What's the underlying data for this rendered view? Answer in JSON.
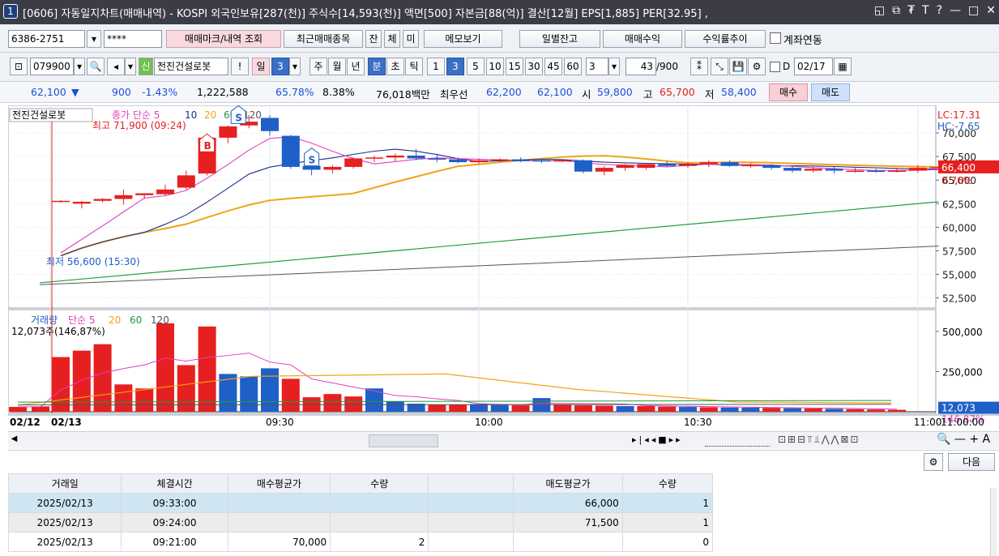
{
  "title": {
    "badge": "1",
    "text": "[0606] 자동일지차트(매매내역) - KOSPI 외국인보유[287(천)] 주식수[14,593(천)] 액면[500] 자본금[88(억)] 결산[12월] EPS[1,885] PER[32.95] ,"
  },
  "toolbar1": {
    "account": "6386-2751",
    "password": "****",
    "btn_trade_mark": "매매마크/내역 조회",
    "btn_recent": "최근매매종목",
    "btn_jan": "잔",
    "btn_che": "체",
    "btn_mi": "미",
    "btn_memo": "메모보기",
    "btn_daily_balance": "일별잔고",
    "btn_trade_profit": "매매수익",
    "btn_return_trend": "수익률추이",
    "chk_account_link": "계좌연동"
  },
  "toolbar2": {
    "code": "079900",
    "new_badge": "신",
    "stock_name": "전진건설로봇",
    "excl": "!",
    "period_il": "일",
    "period_num": "3",
    "ju": "주",
    "wol": "월",
    "nyeon": "년",
    "bun": "분",
    "cho": "초",
    "tik": "틱",
    "intervals": [
      "1",
      "3",
      "5",
      "10",
      "15",
      "30",
      "45",
      "60"
    ],
    "interval_sel": "3",
    "count": "43",
    "total": "/900",
    "chk_d": "D",
    "date": "02/17"
  },
  "quote": {
    "price": "62,100",
    "arrow": "▼",
    "change": "900",
    "rate": "-1.43%",
    "volume": "1,222,588",
    "v_ratio": "65.78%",
    "turnover": "8.38%",
    "amount": "76,018백만",
    "best_label": "최우선",
    "best_ask": "62,200",
    "best_bid": "62,100",
    "open_label": "시",
    "open": "59,800",
    "high_label": "고",
    "high": "65,700",
    "low_label": "저",
    "low": "58,400",
    "buy": "매수",
    "sell": "매도"
  },
  "chart": {
    "legend_name": "전진건설로봇",
    "legend_price": "종가 단순 5",
    "ma10": "10",
    "ma20": "20",
    "ma60": "60",
    "ma120": "120",
    "high_note": "최고 71,900 (09:24)",
    "low_note": "최저 56,600 (15:30)",
    "lc": "LC:17.31",
    "hc": "HC:-7.65",
    "price_axis": [
      "70,000",
      "67,500",
      "65,000",
      "62,500",
      "60,000",
      "57,500",
      "55,000",
      "52,500"
    ],
    "cur_price": "66,400",
    "cur_rate": "0.76%",
    "vol_legend": "거래량",
    "vol_ma": "단순 5",
    "vol_ma20": "20",
    "vol_ma60": "60",
    "vol_ma120": "120",
    "vol_info": "12,073주(146,87%)",
    "vol_axis": [
      "500,000",
      "250,000"
    ],
    "vol_cur": "12,073",
    "vol_rate": "146.87%",
    "time_axis": [
      "02/12",
      "02/13",
      "09:30",
      "10:00",
      "10:30",
      "11:00"
    ],
    "time_end": "11:00:00",
    "candles": [
      [
        62800,
        62900,
        62600,
        62800
      ],
      [
        62500,
        62800,
        62000,
        62700
      ],
      [
        62800,
        63100,
        62600,
        63000
      ],
      [
        63000,
        64000,
        62400,
        63400
      ],
      [
        63400,
        63600,
        63000,
        63600
      ],
      [
        63500,
        64500,
        63300,
        64000
      ],
      [
        64200,
        66000,
        64000,
        65500
      ],
      [
        65700,
        69700,
        65500,
        69500
      ],
      [
        69500,
        70800,
        68900,
        70700
      ],
      [
        70800,
        71900,
        70500,
        71200
      ],
      [
        71600,
        71900,
        69700,
        70200
      ],
      [
        69700,
        69800,
        66200,
        66400
      ],
      [
        66500,
        67200,
        65500,
        66100
      ],
      [
        66100,
        66600,
        65700,
        66400
      ],
      [
        66400,
        67400,
        66200,
        67300
      ],
      [
        67300,
        67600,
        66900,
        67400
      ],
      [
        67400,
        67800,
        67000,
        67600
      ],
      [
        67600,
        68300,
        67100,
        67300
      ],
      [
        67300,
        67800,
        66900,
        67200
      ],
      [
        67200,
        67400,
        66800,
        66900
      ],
      [
        66900,
        67300,
        66700,
        67100
      ],
      [
        67100,
        67300,
        66900,
        67200
      ],
      [
        67200,
        67400,
        66900,
        67000
      ],
      [
        67100,
        67300,
        66800,
        67000
      ],
      [
        67000,
        67200,
        66900,
        67100
      ],
      [
        67100,
        67200,
        65700,
        65900
      ],
      [
        65900,
        66500,
        65500,
        66300
      ],
      [
        66300,
        66700,
        66000,
        66600
      ],
      [
        66300,
        66700,
        66100,
        66700
      ],
      [
        66700,
        67000,
        66400,
        66500
      ],
      [
        66500,
        66900,
        66300,
        66700
      ],
      [
        66700,
        67100,
        66400,
        66900
      ],
      [
        66900,
        67100,
        66400,
        66500
      ],
      [
        66500,
        66800,
        66300,
        66600
      ],
      [
        66600,
        66700,
        66100,
        66300
      ],
      [
        66300,
        66500,
        65800,
        66000
      ],
      [
        66000,
        66400,
        65800,
        66200
      ],
      [
        66200,
        66400,
        65700,
        66000
      ],
      [
        66000,
        66300,
        65800,
        66000
      ],
      [
        66000,
        66200,
        65800,
        65900
      ],
      [
        65900,
        66300,
        65800,
        66000
      ],
      [
        66000,
        66600,
        65800,
        66300
      ],
      [
        66300,
        66500,
        66000,
        66400
      ]
    ],
    "volumes": [
      30000,
      33000,
      340000,
      380000,
      420000,
      170000,
      145000,
      550000,
      290000,
      530000,
      235000,
      220000,
      270000,
      205000,
      90000,
      110000,
      95000,
      145000,
      65000,
      50000,
      45000,
      45000,
      48000,
      42000,
      40000,
      85000,
      43000,
      40000,
      38000,
      35000,
      35000,
      32000,
      30000,
      28000,
      26000,
      25000,
      24000,
      22000,
      20000,
      18000,
      16000,
      14000,
      12073
    ]
  },
  "buttons": {
    "next": "다음"
  },
  "table": {
    "headers": [
      "거래일",
      "체결시간",
      "매수평균가",
      "수량",
      "",
      "매도평균가",
      "수량"
    ],
    "rows": [
      [
        "2025/02/13",
        "09:33:00",
        "",
        "",
        "",
        "66,000",
        "1"
      ],
      [
        "2025/02/13",
        "09:24:00",
        "",
        "",
        "",
        "71,500",
        "1"
      ],
      [
        "2025/02/13",
        "09:21:00",
        "70,000",
        "2",
        "",
        "",
        "0"
      ]
    ]
  }
}
